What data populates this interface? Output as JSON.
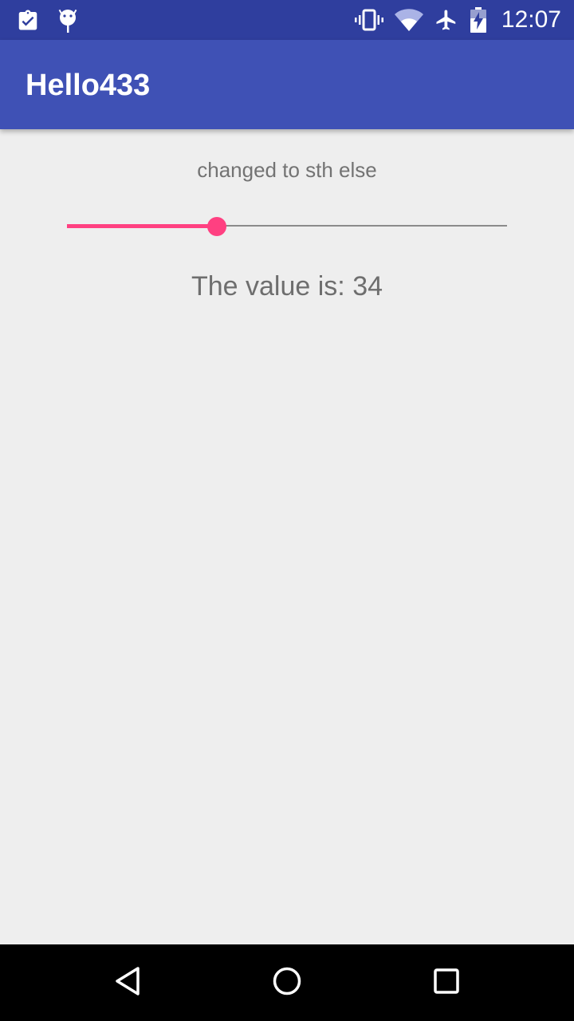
{
  "status_bar": {
    "time": "12:07",
    "left_icons": [
      "clipboard-check-icon",
      "android-icon"
    ],
    "right_icons": [
      "vibrate-icon",
      "wifi-icon",
      "airplane-icon",
      "battery-charging-icon"
    ]
  },
  "app_bar": {
    "title": "Hello433",
    "color": "#3f51b5"
  },
  "main": {
    "subtitle": "changed to sth else",
    "slider": {
      "value": 34,
      "max": 100,
      "accent_color": "#ff4081"
    },
    "value_text": "The value is: 34"
  },
  "nav_bar": {
    "buttons": [
      "back-icon",
      "home-icon",
      "recents-icon"
    ]
  }
}
